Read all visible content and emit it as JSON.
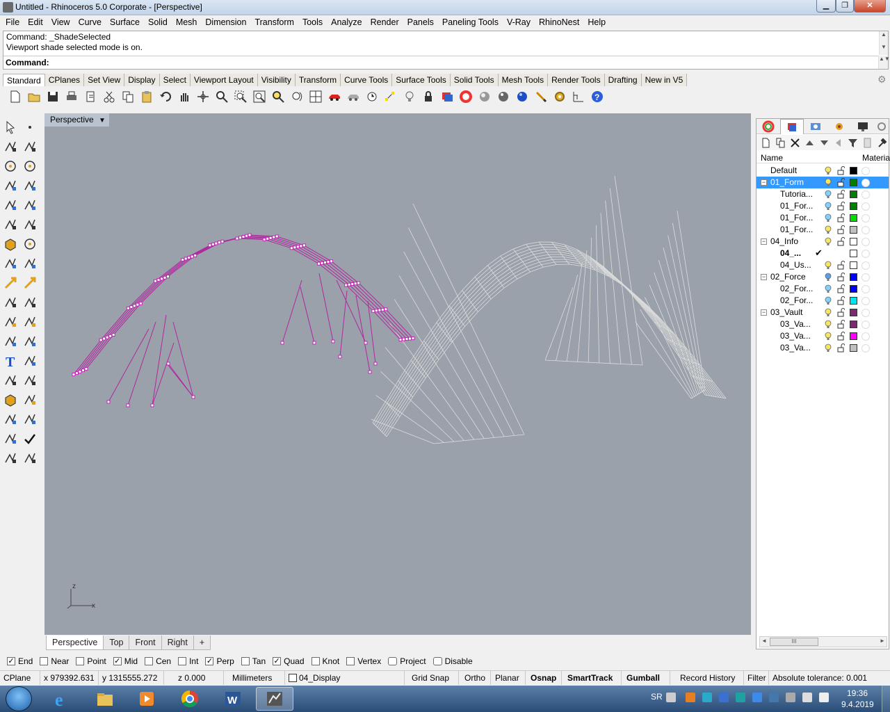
{
  "window": {
    "title": "Untitled - Rhinoceros  5.0 Corporate - [Perspective]"
  },
  "menu": [
    "File",
    "Edit",
    "View",
    "Curve",
    "Surface",
    "Solid",
    "Mesh",
    "Dimension",
    "Transform",
    "Tools",
    "Analyze",
    "Render",
    "Panels",
    "Paneling Tools",
    "V-Ray",
    "RhinoNest",
    "Help"
  ],
  "command": {
    "history_line1": "Command: _ShadeSelected",
    "history_line2": "Viewport shade selected mode is on.",
    "prompt_label": "Command:",
    "input_value": ""
  },
  "toolbar_tabs": [
    "Standard",
    "CPlanes",
    "Set View",
    "Display",
    "Select",
    "Viewport Layout",
    "Visibility",
    "Transform",
    "Curve Tools",
    "Surface Tools",
    "Solid Tools",
    "Mesh Tools",
    "Render Tools",
    "Drafting",
    "New in V5"
  ],
  "toolbar_active_tab": "Standard",
  "standard_icons": [
    "new-file-icon",
    "open-folder-icon",
    "save-icon",
    "print-icon",
    "import-icon",
    "cut-icon",
    "copy-icon",
    "paste-icon",
    "undo-icon",
    "pan-hand-icon",
    "move-icon",
    "zoom-icon",
    "zoom-window-icon",
    "zoom-extents-icon",
    "zoom-selected-icon",
    "rotate-view-icon",
    "grid-4-view-icon",
    "car-icon",
    "car-gray-icon",
    "properties-icon",
    "select-points-icon",
    "lightbulb-icon",
    "lock-icon",
    "layer-icon",
    "color-wheel-icon",
    "shade-sphere-icon",
    "render-sphere-icon",
    "blue-sphere-icon",
    "paint-brush-icon",
    "gear-options-icon",
    "dimension-icon",
    "help-icon"
  ],
  "viewport": {
    "label": "Perspective",
    "axis_z": "z",
    "axis_x": "x",
    "background": "#9ba1aa",
    "mesh_magenta": "#b0279f",
    "mesh_white": "#dcdcdc"
  },
  "view_tabs": [
    "Perspective",
    "Top",
    "Front",
    "Right",
    "+"
  ],
  "view_active": "Perspective",
  "layers_panel": {
    "header_name": "Name",
    "header_material": "Material",
    "layers": [
      {
        "name": "Default",
        "indent": 1,
        "color": "#000000",
        "bulb": "#f5e663",
        "expander": ""
      },
      {
        "name": "01_Form",
        "indent": 1,
        "color": "#008000",
        "bulb": "#f5e663",
        "expander": "−",
        "selected": true
      },
      {
        "name": "Tutoria...",
        "indent": 2,
        "color": "#008000",
        "bulb": "#7fd4ff",
        "expander": ""
      },
      {
        "name": "01_For...",
        "indent": 2,
        "color": "#008000",
        "bulb": "#7fd4ff",
        "expander": ""
      },
      {
        "name": "01_For...",
        "indent": 2,
        "color": "#00dd00",
        "bulb": "#7fd4ff",
        "expander": ""
      },
      {
        "name": "01_For...",
        "indent": 2,
        "color": "#c0c0c0",
        "bulb": "#f5e663",
        "expander": ""
      },
      {
        "name": "04_Info",
        "indent": 1,
        "color": "#ffffff",
        "bulb": "#f5e663",
        "expander": "−"
      },
      {
        "name": "04_...",
        "indent": 2,
        "color": "#ffffff",
        "bulb": "",
        "expander": "",
        "current": true,
        "check": "✔"
      },
      {
        "name": "04_Us...",
        "indent": 2,
        "color": "#ffffff",
        "bulb": "#f5e663",
        "expander": ""
      },
      {
        "name": "02_Force",
        "indent": 1,
        "color": "#0000ff",
        "bulb": "#5aa0e8",
        "expander": "−"
      },
      {
        "name": "02_For...",
        "indent": 2,
        "color": "#0000ff",
        "bulb": "#7fd4ff",
        "expander": ""
      },
      {
        "name": "02_For...",
        "indent": 2,
        "color": "#00e5ee",
        "bulb": "#7fd4ff",
        "expander": ""
      },
      {
        "name": "03_Vault",
        "indent": 1,
        "color": "#7b2a72",
        "bulb": "#f5e663",
        "expander": "−"
      },
      {
        "name": "03_Va...",
        "indent": 2,
        "color": "#7b2a72",
        "bulb": "#f5e663",
        "expander": ""
      },
      {
        "name": "03_Va...",
        "indent": 2,
        "color": "#ff00ff",
        "bulb": "#f5e663",
        "expander": ""
      },
      {
        "name": "03_Va...",
        "indent": 2,
        "color": "#c0c0c0",
        "bulb": "#f5e663",
        "expander": ""
      }
    ],
    "hscroll_glyph": "III"
  },
  "osnaps": [
    {
      "label": "End",
      "checked": true
    },
    {
      "label": "Near",
      "checked": false
    },
    {
      "label": "Point",
      "checked": false
    },
    {
      "label": "Mid",
      "checked": true
    },
    {
      "label": "Cen",
      "checked": false
    },
    {
      "label": "Int",
      "checked": false
    },
    {
      "label": "Perp",
      "checked": true
    },
    {
      "label": "Tan",
      "checked": false
    },
    {
      "label": "Quad",
      "checked": true
    },
    {
      "label": "Knot",
      "checked": false
    },
    {
      "label": "Vertex",
      "checked": false
    },
    {
      "label": "Project",
      "checked": false
    },
    {
      "label": "Disable",
      "checked": false
    }
  ],
  "status": {
    "cplane": "CPlane",
    "x": "x 979392.631",
    "y": "y 1315555.272",
    "z": "z 0.000",
    "units": "Millimeters",
    "layer": "04_Display",
    "grid_snap": "Grid Snap",
    "ortho": "Ortho",
    "planar": "Planar",
    "osnap": "Osnap",
    "smarttrack": "SmartTrack",
    "gumball": "Gumball",
    "record_history": "Record History",
    "filter": "Filter",
    "tolerance": "Absolute tolerance: 0.001"
  },
  "taskbar": {
    "lang": "SR",
    "time": "19:36",
    "date": "9.4.2019"
  }
}
